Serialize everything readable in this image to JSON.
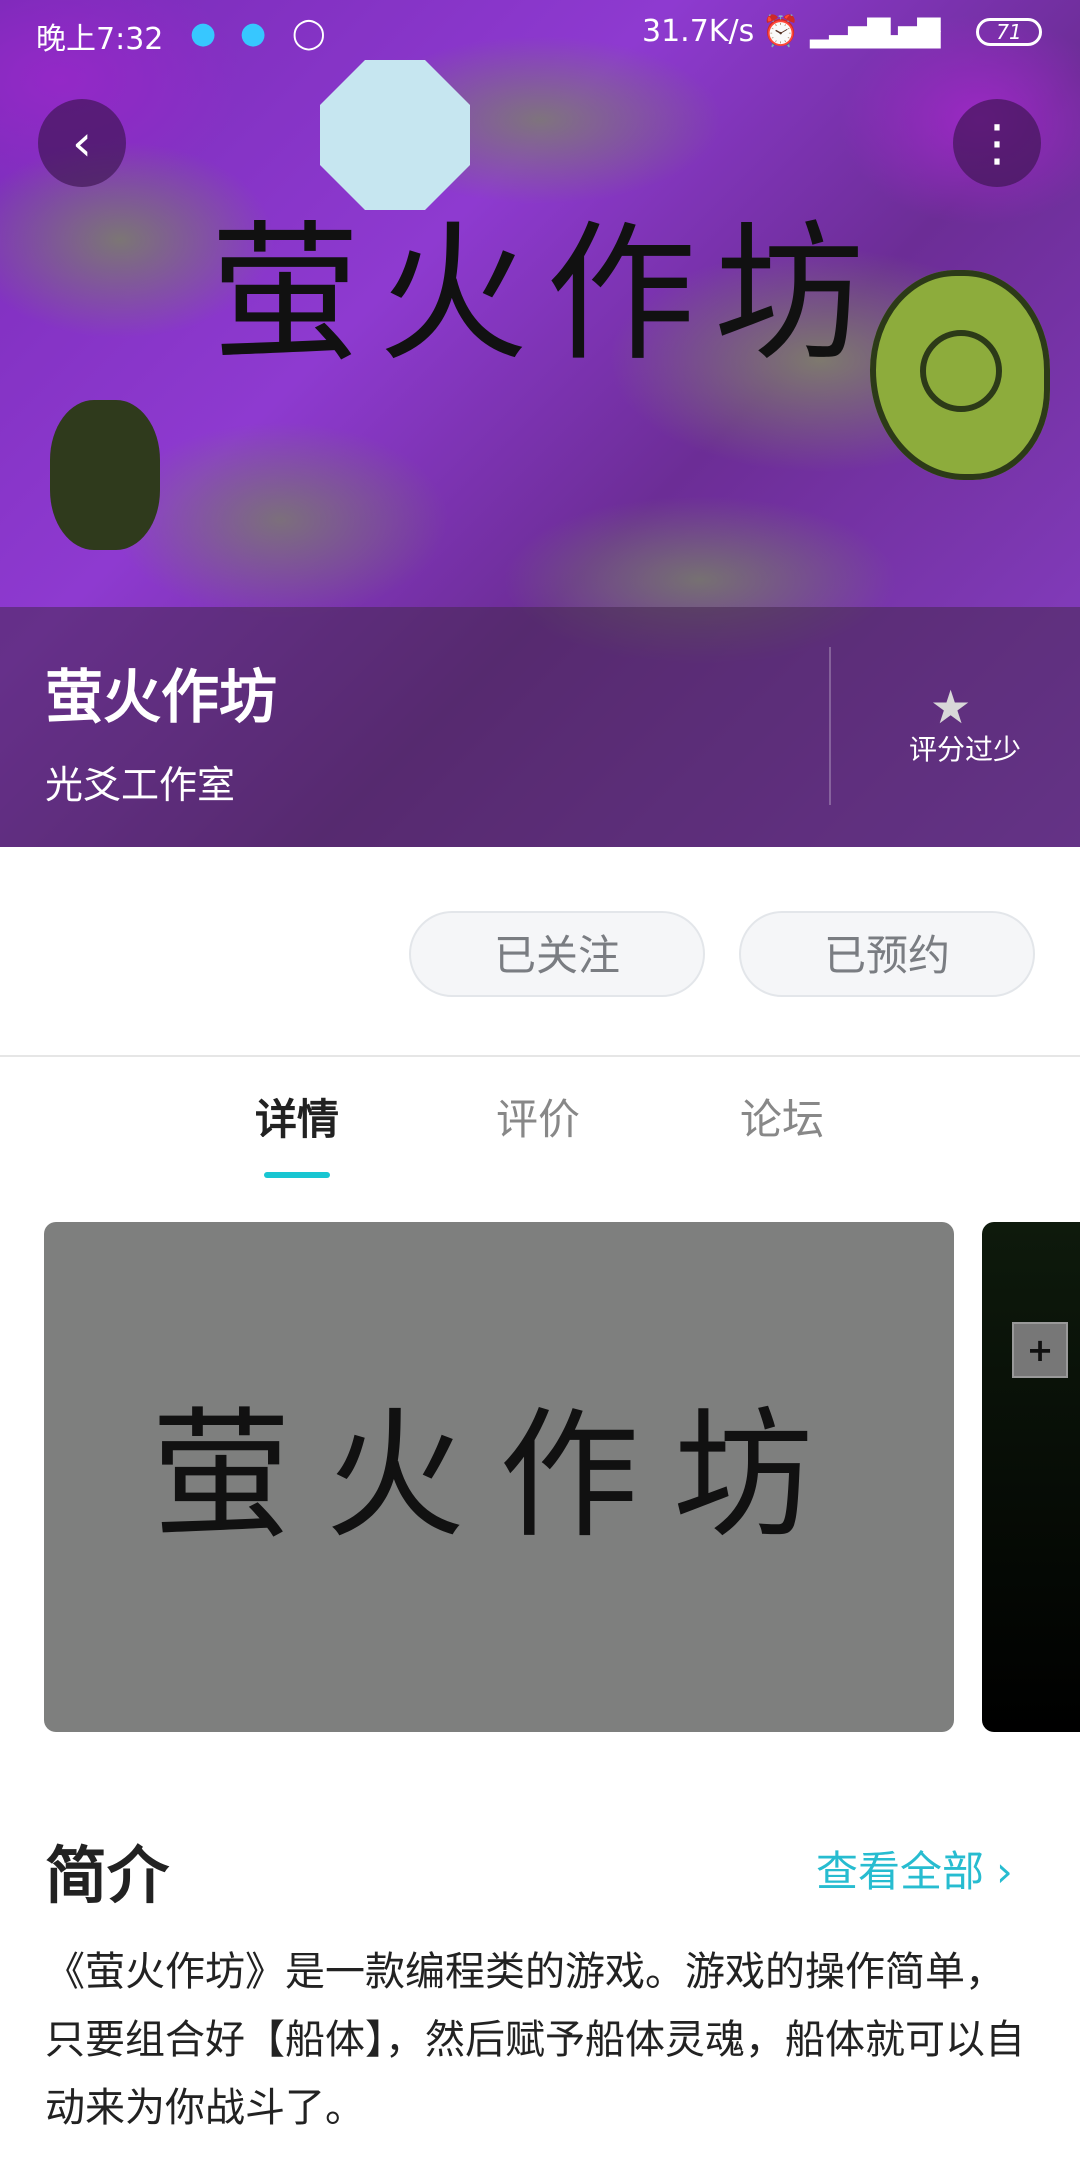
{
  "status_bar": {
    "time": "晚上7:32",
    "network_speed": "31.7K/s",
    "battery": "71",
    "icons": [
      "qq-icon",
      "qq-icon",
      "timer-icon",
      "alarm-icon",
      "signal-icon",
      "signal-hd-icon",
      "wifi-icon",
      "battery-icon"
    ]
  },
  "banner": {
    "art_text": "萤火作坊"
  },
  "game": {
    "title": "萤火作坊",
    "studio": "光爻工作室",
    "rating_label": "评分过少"
  },
  "actions": {
    "follow_label": "已关注",
    "reserve_label": "已预约"
  },
  "tabs": [
    {
      "label": "详情",
      "active": true
    },
    {
      "label": "评价",
      "active": false
    },
    {
      "label": "论坛",
      "active": false
    }
  ],
  "screenshots": {
    "first_text": "萤火作坊",
    "second_button": "+"
  },
  "intro": {
    "title": "简介",
    "view_all": "查看全部",
    "body": "《萤火作坊》是一款编程类的游戏。游戏的操作简单，只要组合好【船体】，然后赋予船体灵魂，船体就可以自动来为你战斗了。"
  },
  "colors": {
    "accent": "#18c6d2",
    "link": "#27bcd0",
    "banner_purple": "#7a2bb8"
  }
}
